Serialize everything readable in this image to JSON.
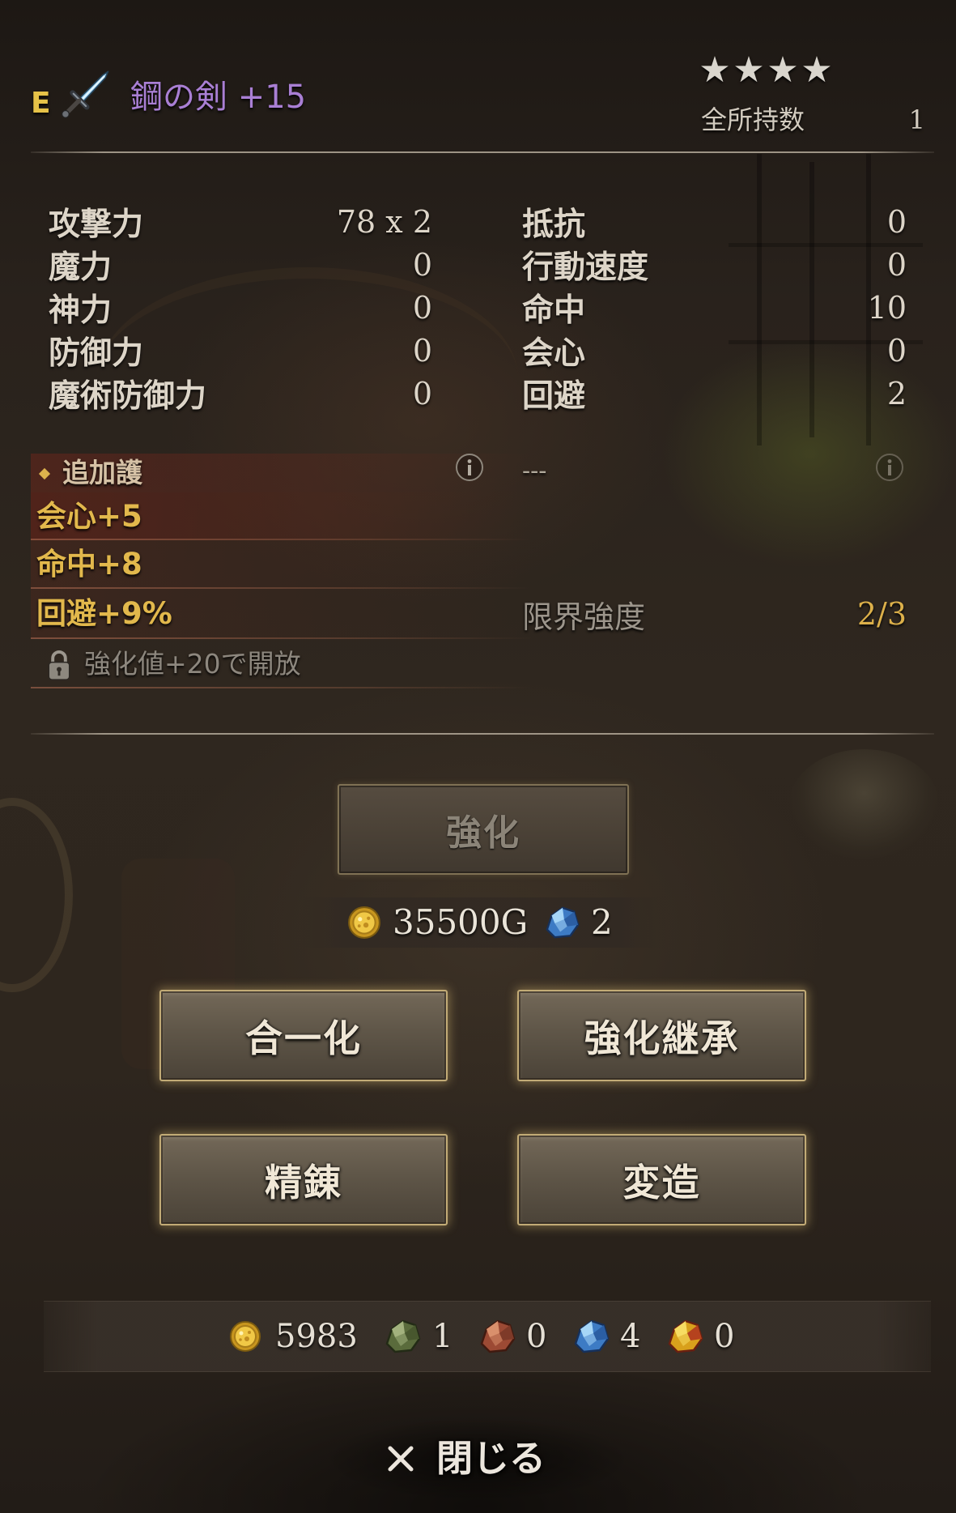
{
  "header": {
    "equipped_badge": "E",
    "weapon_icon": "sword-icon",
    "item_name": "鋼の剣 +15",
    "rarity_stars": 4,
    "owned_count_label": "全所持数",
    "owned_count_value": "1"
  },
  "stats": {
    "left": [
      {
        "label": "攻撃力",
        "value": "78 x 2"
      },
      {
        "label": "魔力",
        "value": "0"
      },
      {
        "label": "神力",
        "value": "0"
      },
      {
        "label": "防御力",
        "value": "0"
      },
      {
        "label": "魔術防御力",
        "value": "0"
      }
    ],
    "right": [
      {
        "label": "抵抗",
        "value": "0"
      },
      {
        "label": "行動速度",
        "value": "0"
      },
      {
        "label": "命中",
        "value": "10"
      },
      {
        "label": "会心",
        "value": "0"
      },
      {
        "label": "回避",
        "value": "2"
      }
    ]
  },
  "extra": {
    "bullet_icon": "diamond-bullet-icon",
    "header_label": "追加護",
    "info_icon": "info-icon",
    "right_slot": "---",
    "bonuses": [
      "会心+5",
      "命中+8",
      "回避+9%"
    ],
    "lock_icon": "lock-icon",
    "locked_text": "強化値+20で開放",
    "limit_label": "限界強度",
    "limit_value": "2/3"
  },
  "enhance": {
    "button_label": "強化",
    "button_enabled": false,
    "cost": [
      {
        "icon": "gold-coin-icon",
        "amount": "35500G"
      },
      {
        "icon": "blue-ore-icon",
        "amount": "2"
      }
    ]
  },
  "actions": [
    {
      "label": "合一化"
    },
    {
      "label": "強化継承"
    },
    {
      "label": "精錬"
    },
    {
      "label": "変造"
    }
  ],
  "resources": [
    {
      "icon": "gold-coin-icon",
      "value": "5983"
    },
    {
      "icon": "green-ore-icon",
      "value": "1"
    },
    {
      "icon": "red-ore-icon",
      "value": "0"
    },
    {
      "icon": "blue-ore-icon",
      "value": "4"
    },
    {
      "icon": "gold-ore-icon",
      "value": "0"
    }
  ],
  "close": {
    "icon": "close-icon",
    "label": "閉じる"
  },
  "colors": {
    "name-purple": "#a97fd4",
    "gold": "#e2b84c",
    "equipped-badge": "#e6c248",
    "text": "#ddd5c8",
    "muted": "#9c958b"
  }
}
